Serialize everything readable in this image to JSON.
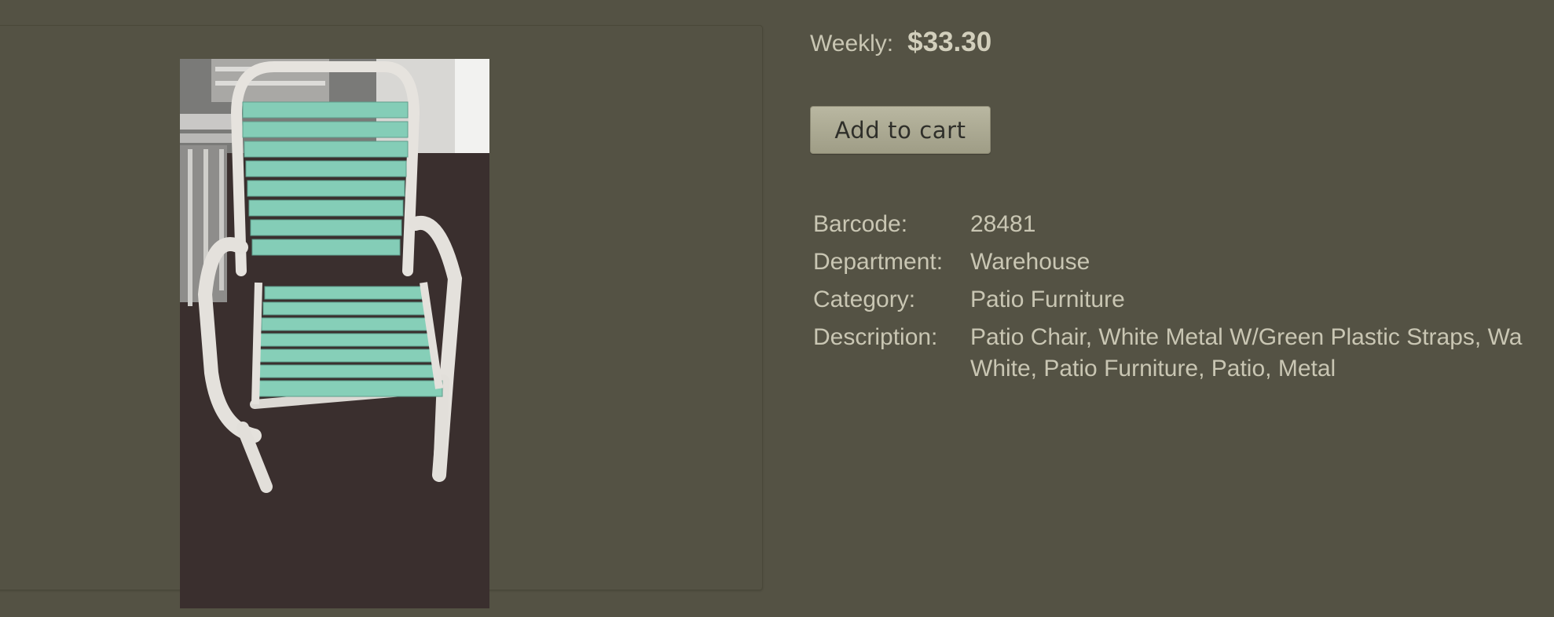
{
  "pricing": {
    "label": "Weekly:",
    "value": "$33.30"
  },
  "cart": {
    "button_label": "Add to cart"
  },
  "details": [
    {
      "label": "Barcode:",
      "value": "28481"
    },
    {
      "label": "Department:",
      "value": "Warehouse"
    },
    {
      "label": "Category:",
      "value": "Patio Furniture"
    },
    {
      "label": "Description:",
      "value": "Patio Chair, White Metal W/Green Plastic Straps, Wa",
      "value_line2": "White, Patio Furniture, Patio, Metal"
    }
  ],
  "colors": {
    "background": "#545244",
    "text": "#c9c6b3",
    "button": "#aeac96",
    "strap_green": "#7ec9b4",
    "frame_white": "#e4e1dc"
  }
}
